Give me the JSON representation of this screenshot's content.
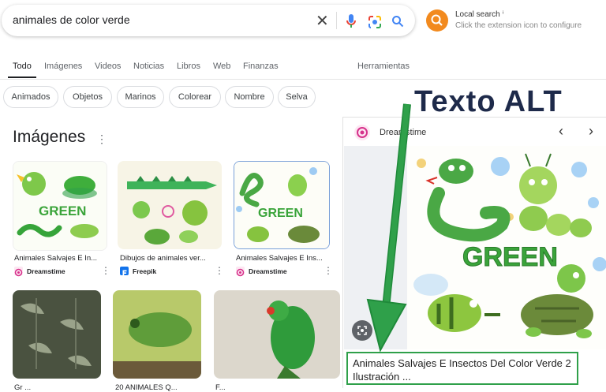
{
  "search": {
    "query": "animales de color verde",
    "clear_icon": "close-icon",
    "icons": [
      "microphone-icon",
      "google-lens-icon",
      "search-icon"
    ]
  },
  "local_search": {
    "title": "Local search",
    "info_mark": "ⁱ",
    "subtitle": "Click the extension icon to configure"
  },
  "tabs": [
    {
      "label": "Todo",
      "active": true
    },
    {
      "label": "Imágenes"
    },
    {
      "label": "Videos"
    },
    {
      "label": "Noticias"
    },
    {
      "label": "Libros"
    },
    {
      "label": "Web"
    },
    {
      "label": "Finanzas"
    }
  ],
  "tools_label": "Herramientas",
  "chips": [
    "Animados",
    "Objetos",
    "Marinos",
    "Colorear",
    "Nombre",
    "Selva"
  ],
  "section_title": "Imágenes",
  "results_row1": [
    {
      "caption": "Animales Salvajes E In...",
      "source": "Dreamstime"
    },
    {
      "caption": "Dibujos de animales ver...",
      "source": "Freepik"
    },
    {
      "caption": "Animales Salvajes E Ins...",
      "source": "Dreamstime"
    }
  ],
  "results_row2": [
    {
      "caption": "Gr ..."
    },
    {
      "caption": "20 ANIMALES Q..."
    },
    {
      "caption": "F..."
    }
  ],
  "panel": {
    "source": "Dreamstime",
    "prev_icon": "chevron-left-icon",
    "next_icon": "chevron-right-icon",
    "image_text": "GREEN",
    "alt_text": "Animales Salvajes E Insectos Del Color Verde 2 Ilustración ..."
  },
  "annotation": {
    "title": "Texto ALT",
    "arrow_color": "#2fa04a"
  },
  "colors": {
    "accent_orange": "#f28a1e",
    "dreamstime_pink": "#d6318b",
    "freepik_blue": "#1273eb",
    "highlight_green": "#2fa04a"
  }
}
